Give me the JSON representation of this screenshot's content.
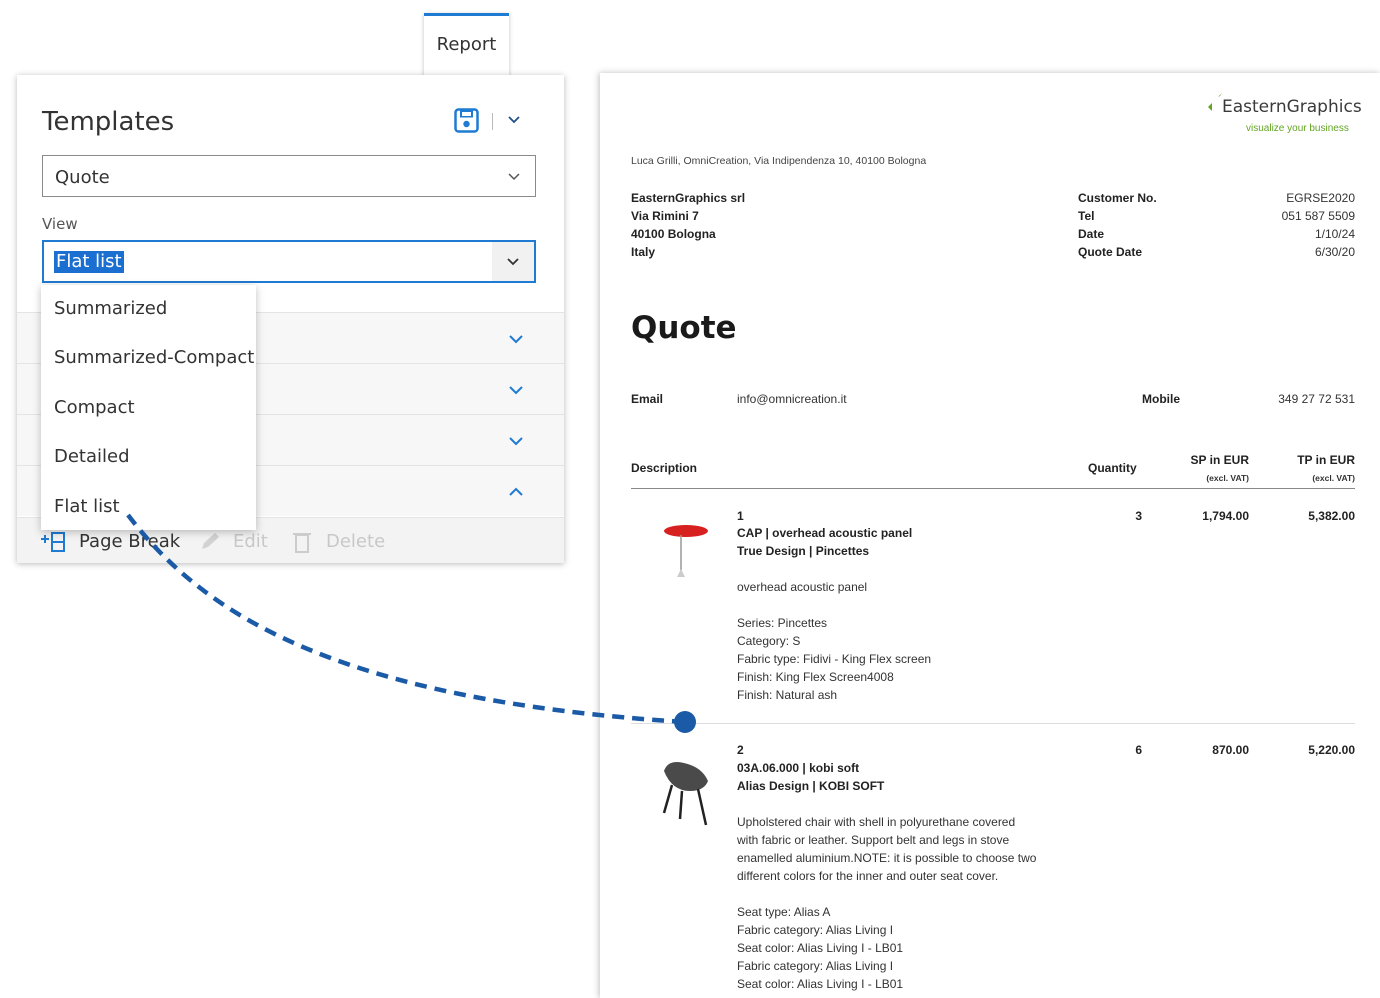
{
  "report_tab": {
    "label": "Report"
  },
  "templates_panel": {
    "title": "Templates",
    "template_select": {
      "value": "Quote"
    },
    "view_label": "View",
    "view_select": {
      "value": "Flat list"
    },
    "view_options": [
      "Summarized",
      "Summarized-Compact",
      "Compact",
      "Detailed",
      "Flat list"
    ],
    "toolbar": {
      "page_break": "Page Break",
      "edit": "Edit",
      "delete": "Delete"
    }
  },
  "document": {
    "logo": {
      "name": "EasternGraphics",
      "tagline": "visualize your business"
    },
    "sender_line": "Luca Grilli, OmniCreation, Via Indipendenza 10, 40100 Bologna",
    "recipient": [
      "EasternGraphics srl",
      "Via Rimini 7",
      "40100 Bologna",
      "Italy"
    ],
    "meta": [
      {
        "label": "Customer No.",
        "value": "EGRSE2020"
      },
      {
        "label": "Tel",
        "value": "051 587 5509"
      },
      {
        "label": "Date",
        "value": "1/10/24"
      },
      {
        "label": "Quote Date",
        "value": "6/30/20"
      }
    ],
    "title": "Quote",
    "contact": {
      "email_label": "Email",
      "email_value": "info@omnicreation.it",
      "mobile_label": "Mobile",
      "mobile_value": "349 27 72 531"
    },
    "table_header": {
      "description": "Description",
      "quantity": "Quantity",
      "sp": "SP in EUR",
      "tp": "TP in EUR",
      "excl": "(excl. VAT)"
    },
    "items": [
      {
        "pos": "1",
        "title": "CAP | overhead acoustic panel",
        "subtitle": "True Design | Pincettes",
        "quantity": "3",
        "sp": "1,794.00",
        "tp": "5,382.00",
        "short": "overhead acoustic panel",
        "details": [
          "Series: Pincettes",
          "Category: S",
          "Fabric type: Fidivi - King Flex screen",
          "Finish: King Flex Screen4008",
          "Finish: Natural ash"
        ]
      },
      {
        "pos": "2",
        "title": "03A.06.000 | kobi soft",
        "subtitle": "Alias Design | KOBI SOFT",
        "quantity": "6",
        "sp": "870.00",
        "tp": "5,220.00",
        "long": [
          "Upholstered chair with shell in polyurethane covered",
          "with fabric or leather. Support belt and legs in stove",
          "enamelled aluminium.NOTE: it is possible to choose two",
          "different colors for the inner and outer seat cover."
        ],
        "details": [
          "Seat type: Alias A",
          "Fabric category: Alias Living I",
          "Seat color: Alias Living I - LB01",
          "Fabric category: Alias Living I",
          "Seat color: Alias Living I - LB01"
        ]
      }
    ]
  },
  "colors": {
    "accent": "#1f7ad1",
    "connector": "#1a5aa6",
    "logo_green": "#63a425"
  }
}
